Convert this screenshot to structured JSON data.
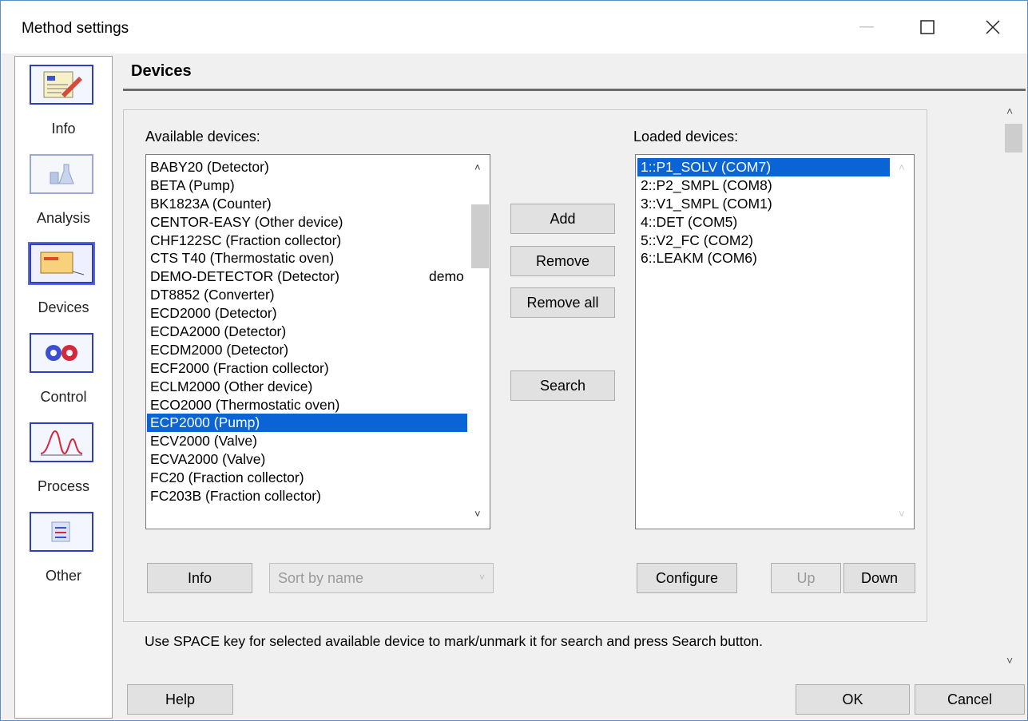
{
  "window": {
    "title": "Method settings",
    "minimize": "—",
    "maximize": "☐",
    "close": "✕"
  },
  "sidebar": {
    "items": [
      {
        "label": "Info"
      },
      {
        "label": "Analysis"
      },
      {
        "label": "Devices"
      },
      {
        "label": "Control"
      },
      {
        "label": "Process"
      },
      {
        "label": "Other"
      }
    ]
  },
  "section": {
    "title": "Devices"
  },
  "available": {
    "label": "Available devices:",
    "items": [
      "BABY20 (Detector)",
      "BETA (Pump)",
      "BK1823A (Counter)",
      "CENTOR-EASY (Other device)",
      "CHF122SC (Fraction collector)",
      "CTS T40 (Thermostatic oven)",
      "DEMO-DETECTOR (Detector)",
      "DT8852 (Converter)",
      "ECD2000 (Detector)",
      "ECDA2000 (Detector)",
      "ECDM2000 (Detector)",
      "ECF2000 (Fraction collector)",
      "ECLM2000 (Other device)",
      "ECO2000 (Thermostatic oven)",
      "ECP2000 (Pump)",
      "ECV2000 (Valve)",
      "ECVA2000 (Valve)",
      "FC20 (Fraction collector)",
      "FC203B (Fraction collector)"
    ],
    "selected_item": "ECP2000 (Pump)",
    "demo_mark": "demo",
    "scroll_up": "˄",
    "scroll_down": "˅"
  },
  "loaded": {
    "label": "Loaded devices:",
    "items": [
      "1::P1_SOLV (COM7)",
      "2::P2_SMPL (COM8)",
      "3::V1_SMPL (COM1)",
      "4::DET (COM5)",
      "5::V2_FC (COM2)",
      "6::LEAKM (COM6)"
    ],
    "selected_item": "1::P1_SOLV (COM7)",
    "scroll_up": "˄",
    "scroll_down": "˅"
  },
  "buttons": {
    "add": "Add",
    "remove": "Remove",
    "remove_all": "Remove all",
    "search": "Search",
    "info": "Info",
    "configure": "Configure",
    "up": "Up",
    "down": "Down",
    "help": "Help",
    "ok": "OK",
    "cancel": "Cancel"
  },
  "sort_combo": {
    "value": "Sort by name",
    "arrow": "˅"
  },
  "hint": "Use SPACE key for selected available device to mark/unmark it for search and press Search button.",
  "page_scroll": {
    "up": "˄",
    "down": "˅"
  },
  "colors": {
    "selection": "#0a64d6",
    "accent": "#2f3fbf"
  }
}
